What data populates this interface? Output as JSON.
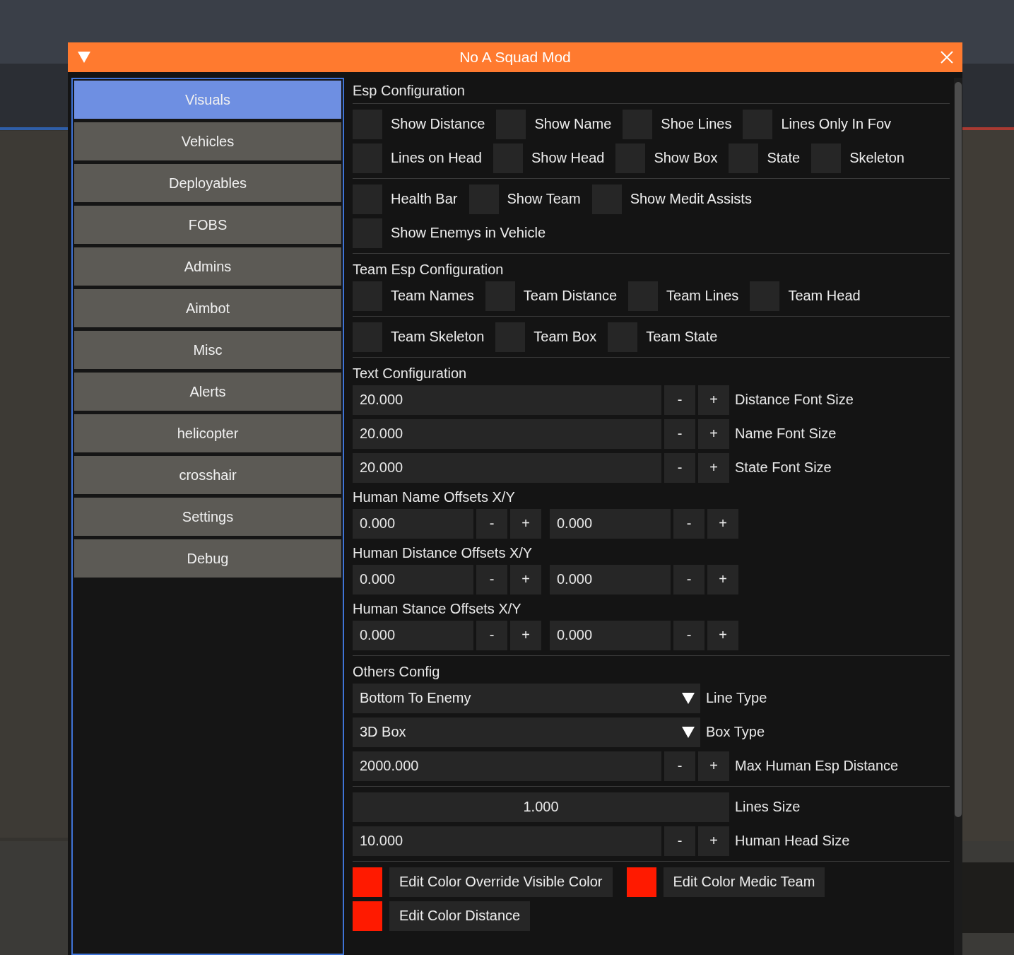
{
  "window": {
    "title": "No A Squad Mod"
  },
  "sidebar": {
    "items": [
      {
        "label": "Visuals",
        "selected": true
      },
      {
        "label": "Vehicles",
        "selected": false
      },
      {
        "label": "Deployables",
        "selected": false
      },
      {
        "label": "FOBS",
        "selected": false
      },
      {
        "label": "Admins",
        "selected": false
      },
      {
        "label": "Aimbot",
        "selected": false
      },
      {
        "label": "Misc",
        "selected": false
      },
      {
        "label": "Alerts",
        "selected": false
      },
      {
        "label": "helicopter",
        "selected": false
      },
      {
        "label": "crosshair",
        "selected": false
      },
      {
        "label": "Settings",
        "selected": false
      },
      {
        "label": "Debug",
        "selected": false
      }
    ]
  },
  "sections": [
    {
      "title": "Esp Configuration",
      "rows": [
        {
          "kind": "separator"
        },
        {
          "kind": "checks",
          "items": [
            {
              "label": "Show Distance",
              "checked": false
            },
            {
              "label": "Show Name",
              "checked": false
            },
            {
              "label": "Shoe Lines",
              "checked": false
            },
            {
              "label": "Lines Only In Fov",
              "checked": false
            }
          ]
        },
        {
          "kind": "checks",
          "items": [
            {
              "label": "Lines on Head",
              "checked": false
            },
            {
              "label": "Show Head",
              "checked": false
            },
            {
              "label": "Show Box",
              "checked": false
            },
            {
              "label": "State",
              "checked": false
            },
            {
              "label": "Skeleton",
              "checked": false
            }
          ]
        },
        {
          "kind": "separator"
        },
        {
          "kind": "checks",
          "items": [
            {
              "label": "Health Bar",
              "checked": false
            },
            {
              "label": "Show Team",
              "checked": false
            },
            {
              "label": "Show Medit Assists",
              "checked": false
            }
          ]
        },
        {
          "kind": "checks",
          "items": [
            {
              "label": "Show Enemys in Vehicle",
              "checked": false
            }
          ]
        },
        {
          "kind": "separator"
        }
      ]
    },
    {
      "title": "Team Esp Configuration",
      "rows": [
        {
          "kind": "checks",
          "items": [
            {
              "label": "Team Names",
              "checked": false
            },
            {
              "label": "Team Distance",
              "checked": false
            },
            {
              "label": "Team Lines",
              "checked": false
            },
            {
              "label": "Team Head",
              "checked": false
            }
          ]
        },
        {
          "kind": "separator"
        },
        {
          "kind": "checks",
          "items": [
            {
              "label": "Team Skeleton",
              "checked": false
            },
            {
              "label": "Team Box",
              "checked": false
            },
            {
              "label": "Team State",
              "checked": false
            }
          ]
        },
        {
          "kind": "separator"
        }
      ]
    },
    {
      "title": "Text Configuration",
      "rows": [
        {
          "kind": "stepper",
          "value": "20.000",
          "minus": "-",
          "plus": "+",
          "label": "Distance Font Size"
        },
        {
          "kind": "stepper",
          "value": "20.000",
          "minus": "-",
          "plus": "+",
          "label": "Name Font Size"
        },
        {
          "kind": "stepper",
          "value": "20.000",
          "minus": "-",
          "plus": "+",
          "label": "State Font Size"
        }
      ]
    },
    {
      "title": "Human Name Offsets X/Y",
      "rows": [
        {
          "kind": "pair",
          "fields": [
            {
              "value": "0.000",
              "minus": "-",
              "plus": "+"
            },
            {
              "value": "0.000",
              "minus": "-",
              "plus": "+"
            }
          ]
        }
      ]
    },
    {
      "title": "Human Distance Offsets X/Y",
      "rows": [
        {
          "kind": "pair",
          "fields": [
            {
              "value": "0.000",
              "minus": "-",
              "plus": "+"
            },
            {
              "value": "0.000",
              "minus": "-",
              "plus": "+"
            }
          ]
        }
      ]
    },
    {
      "title": "Human Stance Offsets X/Y",
      "rows": [
        {
          "kind": "pair",
          "fields": [
            {
              "value": "0.000",
              "minus": "-",
              "plus": "+"
            },
            {
              "value": "0.000",
              "minus": "-",
              "plus": "+"
            }
          ]
        },
        {
          "kind": "separator"
        }
      ]
    },
    {
      "title": "Others Config",
      "rows": [
        {
          "kind": "combo",
          "value": "Bottom To Enemy",
          "label": "Line Type"
        },
        {
          "kind": "combo",
          "value": "3D Box",
          "label": "Box Type"
        },
        {
          "kind": "stepper",
          "value": "2000.000",
          "minus": "-",
          "plus": "+",
          "label": "Max Human Esp Distance"
        },
        {
          "kind": "separator"
        },
        {
          "kind": "value",
          "value": "1.000",
          "label": "Lines Size"
        },
        {
          "kind": "stepper",
          "value": "10.000",
          "minus": "-",
          "plus": "+",
          "label": "Human Head Size"
        },
        {
          "kind": "separator"
        },
        {
          "kind": "colors",
          "items": [
            {
              "label": "Edit Color Override Visible Color",
              "color": "#ff1a00"
            },
            {
              "label": "Edit Color Medic Team",
              "color": "#ff1a00"
            }
          ]
        },
        {
          "kind": "colors",
          "items": [
            {
              "label": "Edit Color Distance",
              "color": "#ff1a00"
            }
          ]
        }
      ]
    }
  ]
}
